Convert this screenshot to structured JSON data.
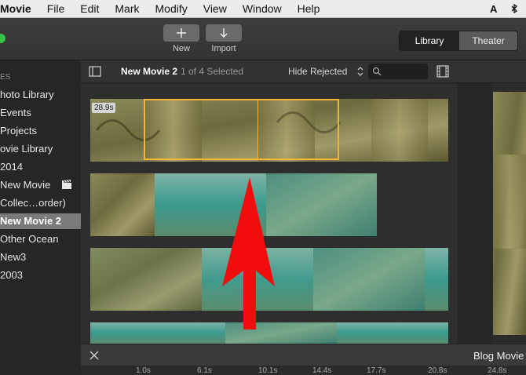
{
  "menubar": {
    "app": "Movie",
    "items": [
      "File",
      "Edit",
      "Mark",
      "Modify",
      "View",
      "Window",
      "Help"
    ]
  },
  "toolbar": {
    "new_label": "New",
    "import_label": "Import",
    "library_label": "Library",
    "theater_label": "Theater"
  },
  "sidebar": {
    "header": "ES",
    "items": [
      {
        "label": "hoto Library"
      },
      {
        "label": "Events"
      },
      {
        "label": "Projects"
      },
      {
        "label": "ovie Library"
      },
      {
        "label": "2014"
      },
      {
        "label": "New Movie"
      },
      {
        "label": "Collec…order)"
      },
      {
        "label": "New Movie 2"
      },
      {
        "label": "Other Ocean"
      },
      {
        "label": "New3"
      },
      {
        "label": "2003"
      }
    ]
  },
  "browser": {
    "title": "New Movie 2",
    "selection_info": "1 of 4 Selected",
    "filter": "Hide Rejected",
    "search_placeholder": "",
    "clip_duration": "28.9s"
  },
  "timeline": {
    "title": "Blog Movie",
    "ticks": [
      "1.0s",
      "6.1s",
      "10.1s",
      "14.4s",
      "17.7s",
      "20.8s",
      "24.8s"
    ]
  }
}
